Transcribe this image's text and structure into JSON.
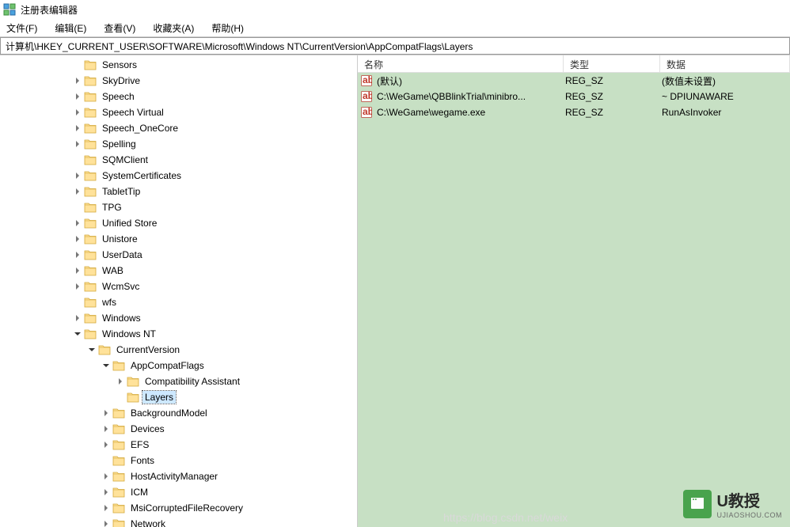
{
  "window": {
    "title": "注册表编辑器"
  },
  "menu": {
    "file": "文件(F)",
    "edit": "编辑(E)",
    "view": "查看(V)",
    "favorites": "收藏夹(A)",
    "help": "帮助(H)"
  },
  "address": {
    "value": "计算机\\HKEY_CURRENT_USER\\SOFTWARE\\Microsoft\\Windows NT\\CurrentVersion\\AppCompatFlags\\Layers"
  },
  "tree": [
    {
      "label": "Sensors",
      "indent": 5,
      "toggle": ""
    },
    {
      "label": "SkyDrive",
      "indent": 5,
      "toggle": ">"
    },
    {
      "label": "Speech",
      "indent": 5,
      "toggle": ">"
    },
    {
      "label": "Speech Virtual",
      "indent": 5,
      "toggle": ">"
    },
    {
      "label": "Speech_OneCore",
      "indent": 5,
      "toggle": ">"
    },
    {
      "label": "Spelling",
      "indent": 5,
      "toggle": ">"
    },
    {
      "label": "SQMClient",
      "indent": 5,
      "toggle": ""
    },
    {
      "label": "SystemCertificates",
      "indent": 5,
      "toggle": ">"
    },
    {
      "label": "TabletTip",
      "indent": 5,
      "toggle": ">"
    },
    {
      "label": "TPG",
      "indent": 5,
      "toggle": ""
    },
    {
      "label": "Unified Store",
      "indent": 5,
      "toggle": ">"
    },
    {
      "label": "Unistore",
      "indent": 5,
      "toggle": ">"
    },
    {
      "label": "UserData",
      "indent": 5,
      "toggle": ">"
    },
    {
      "label": "WAB",
      "indent": 5,
      "toggle": ">"
    },
    {
      "label": "WcmSvc",
      "indent": 5,
      "toggle": ">"
    },
    {
      "label": "wfs",
      "indent": 5,
      "toggle": ""
    },
    {
      "label": "Windows",
      "indent": 5,
      "toggle": ">"
    },
    {
      "label": "Windows NT",
      "indent": 5,
      "toggle": "v"
    },
    {
      "label": "CurrentVersion",
      "indent": 6,
      "toggle": "v"
    },
    {
      "label": "AppCompatFlags",
      "indent": 7,
      "toggle": "v"
    },
    {
      "label": "Compatibility Assistant",
      "indent": 8,
      "toggle": ">"
    },
    {
      "label": "Layers",
      "indent": 8,
      "toggle": "",
      "selected": true
    },
    {
      "label": "BackgroundModel",
      "indent": 7,
      "toggle": ">"
    },
    {
      "label": "Devices",
      "indent": 7,
      "toggle": ">"
    },
    {
      "label": "EFS",
      "indent": 7,
      "toggle": ">"
    },
    {
      "label": "Fonts",
      "indent": 7,
      "toggle": ""
    },
    {
      "label": "HostActivityManager",
      "indent": 7,
      "toggle": ">"
    },
    {
      "label": "ICM",
      "indent": 7,
      "toggle": ">"
    },
    {
      "label": "MsiCorruptedFileRecovery",
      "indent": 7,
      "toggle": ">"
    },
    {
      "label": "Network",
      "indent": 7,
      "toggle": ">"
    }
  ],
  "columns": {
    "name": "名称",
    "type": "类型",
    "data": "数据"
  },
  "values": [
    {
      "name": "(默认)",
      "type": "REG_SZ",
      "data": "(数值未设置)"
    },
    {
      "name": "C:\\WeGame\\QBBlinkTrial\\minibro...",
      "type": "REG_SZ",
      "data": "~ DPIUNAWARE"
    },
    {
      "name": "C:\\WeGame\\wegame.exe",
      "type": "REG_SZ",
      "data": "RunAsInvoker"
    }
  ],
  "watermark": {
    "brand": "U教授",
    "sub": "UJIAOSHOU.COM",
    "url": "https://blog.csdn.net/weix"
  }
}
